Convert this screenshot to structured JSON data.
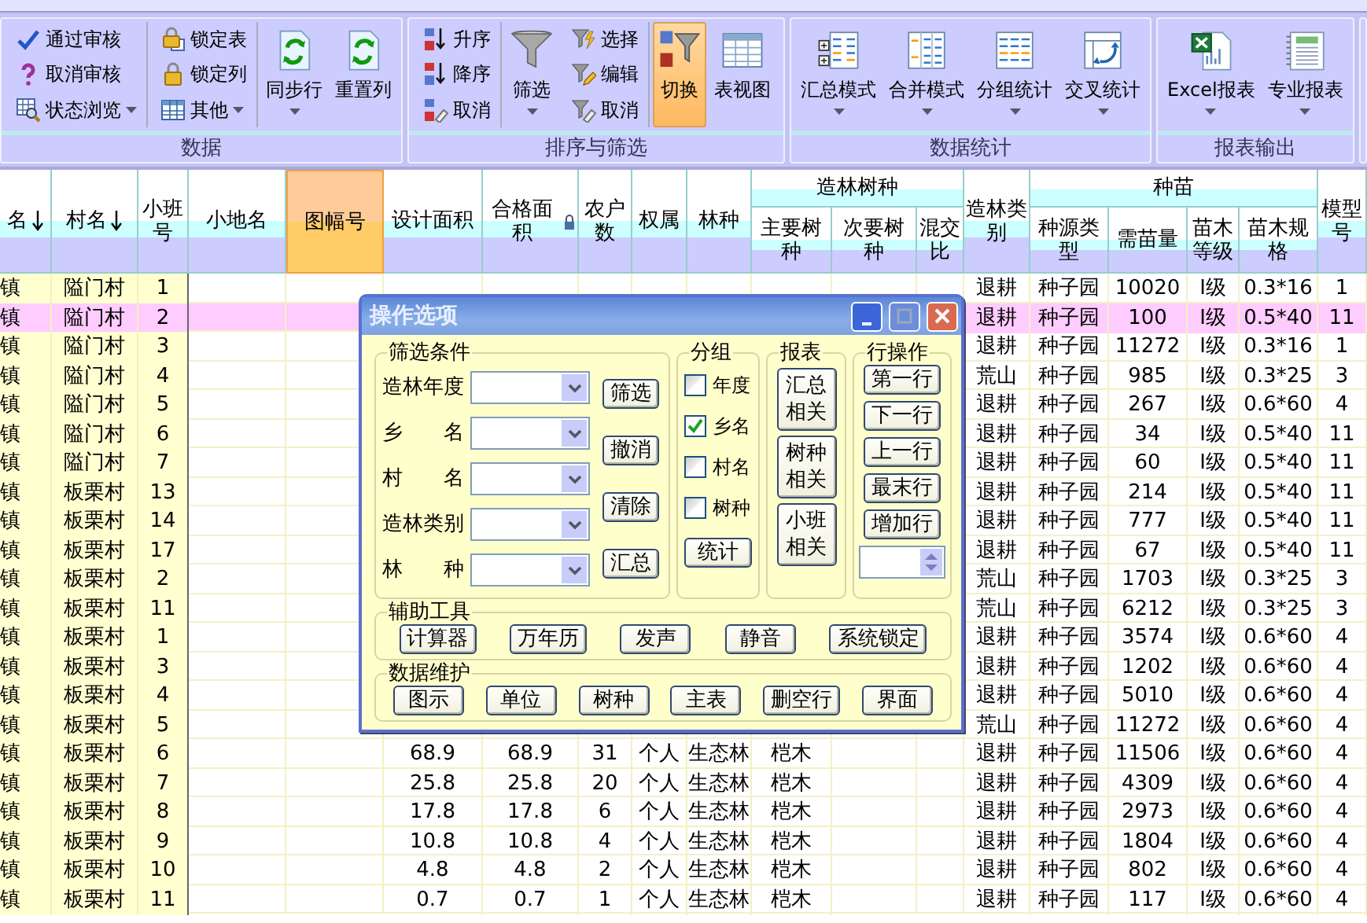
{
  "ribbon": {
    "groups": [
      {
        "title": "数据",
        "columns": [
          {
            "kind": "stack",
            "items": [
              {
                "label": "通过审核",
                "dropdown": false
              },
              {
                "label": "取消审核",
                "dropdown": false
              },
              {
                "label": "状态浏览",
                "dropdown": true
              }
            ]
          },
          {
            "kind": "stack",
            "items": [
              {
                "label": "锁定表",
                "dropdown": false
              },
              {
                "label": "锁定列",
                "dropdown": false
              },
              {
                "label": "其他",
                "dropdown": true
              }
            ]
          },
          {
            "kind": "large",
            "label": "同步行",
            "dropdown": true,
            "selected": false
          },
          {
            "kind": "large",
            "label": "重置列",
            "dropdown": false,
            "selected": false
          }
        ]
      },
      {
        "title": "排序与筛选",
        "columns": [
          {
            "kind": "stack",
            "items": [
              {
                "label": "升序",
                "dropdown": false
              },
              {
                "label": "降序",
                "dropdown": false
              },
              {
                "label": "取消",
                "dropdown": false
              }
            ]
          },
          {
            "kind": "large",
            "label": "筛选",
            "dropdown": true,
            "selected": false
          },
          {
            "kind": "stack",
            "items": [
              {
                "label": "选择",
                "dropdown": false
              },
              {
                "label": "编辑",
                "dropdown": false
              },
              {
                "label": "取消",
                "dropdown": false
              }
            ]
          },
          {
            "kind": "large",
            "label": "切换",
            "dropdown": false,
            "selected": true
          },
          {
            "kind": "large",
            "label": "表视图",
            "dropdown": false,
            "selected": false
          }
        ]
      },
      {
        "title": "数据统计",
        "columns": [
          {
            "kind": "large",
            "label": "汇总模式",
            "dropdown": true,
            "selected": false
          },
          {
            "kind": "large",
            "label": "合并模式",
            "dropdown": true,
            "selected": false
          },
          {
            "kind": "large",
            "label": "分组统计",
            "dropdown": true,
            "selected": false
          },
          {
            "kind": "large",
            "label": "交叉统计",
            "dropdown": true,
            "selected": false
          }
        ]
      },
      {
        "title": "报表输出",
        "columns": [
          {
            "kind": "large",
            "label": "Excel报表",
            "dropdown": true,
            "selected": false
          },
          {
            "kind": "large",
            "label": "专业报表",
            "dropdown": true,
            "selected": false
          }
        ]
      }
    ]
  },
  "table": {
    "columns": [
      {
        "label": "名",
        "sort": true,
        "selected": false
      },
      {
        "label": "村名",
        "sort": true,
        "selected": false
      },
      {
        "label": "小班号",
        "selected": false
      },
      {
        "label": "小地名",
        "selected": false
      },
      {
        "label": "图幅号",
        "selected": true
      },
      {
        "label": "设计面积",
        "selected": false
      },
      {
        "label": "合格面积",
        "locked": true,
        "selected": false
      },
      {
        "label": "农户数",
        "selected": false
      },
      {
        "label": "权属",
        "selected": false
      },
      {
        "label": "林种",
        "selected": false
      },
      {
        "label": "主要树种",
        "group_label": "造林树种",
        "selected": false
      },
      {
        "label": "次要树种",
        "in_group": true,
        "selected": false
      },
      {
        "label": "混交比",
        "in_group": true,
        "selected": false
      },
      {
        "label": "造林类别",
        "selected": false
      },
      {
        "label": "种源类型",
        "group_label": "种苗",
        "selected": false
      },
      {
        "label": "需苗量",
        "in_group": true,
        "selected": false
      },
      {
        "label": "苗木等级",
        "in_group": true,
        "selected": false
      },
      {
        "label": "苗木规格",
        "in_group": true,
        "selected": false
      },
      {
        "label": "模型号",
        "selected": false
      }
    ],
    "rows": [
      {
        "selected": false,
        "cells": [
          "镇",
          "隘门村",
          "1",
          null,
          null,
          null,
          null,
          null,
          null,
          null,
          null,
          null,
          null,
          "退耕",
          "种子园",
          "10020",
          "Ⅰ级",
          "0.3*16",
          "1"
        ]
      },
      {
        "selected": true,
        "cells": [
          "镇",
          "隘门村",
          "2",
          null,
          null,
          null,
          null,
          null,
          null,
          null,
          null,
          null,
          null,
          "退耕",
          "种子园",
          "100",
          "Ⅰ级",
          "0.5*40",
          "11"
        ]
      },
      {
        "selected": false,
        "cells": [
          "镇",
          "隘门村",
          "3",
          null,
          null,
          null,
          null,
          null,
          null,
          null,
          null,
          null,
          null,
          "退耕",
          "种子园",
          "11272",
          "Ⅰ级",
          "0.3*16",
          "1"
        ]
      },
      {
        "selected": false,
        "cells": [
          "镇",
          "隘门村",
          "4",
          null,
          null,
          null,
          null,
          null,
          null,
          null,
          null,
          null,
          null,
          "荒山",
          "种子园",
          "985",
          "Ⅰ级",
          "0.3*25",
          "3"
        ]
      },
      {
        "selected": false,
        "cells": [
          "镇",
          "隘门村",
          "5",
          null,
          null,
          null,
          null,
          null,
          null,
          null,
          null,
          null,
          null,
          "退耕",
          "种子园",
          "267",
          "Ⅰ级",
          "0.6*60",
          "4"
        ]
      },
      {
        "selected": false,
        "cells": [
          "镇",
          "隘门村",
          "6",
          null,
          null,
          null,
          null,
          null,
          null,
          null,
          null,
          null,
          null,
          "退耕",
          "种子园",
          "34",
          "Ⅰ级",
          "0.5*40",
          "11"
        ]
      },
      {
        "selected": false,
        "cells": [
          "镇",
          "隘门村",
          "7",
          null,
          null,
          null,
          null,
          null,
          null,
          null,
          null,
          null,
          null,
          "退耕",
          "种子园",
          "60",
          "Ⅰ级",
          "0.5*40",
          "11"
        ]
      },
      {
        "selected": false,
        "cells": [
          "镇",
          "板栗村",
          "13",
          null,
          null,
          null,
          null,
          null,
          null,
          null,
          null,
          null,
          null,
          "退耕",
          "种子园",
          "214",
          "Ⅰ级",
          "0.5*40",
          "11"
        ]
      },
      {
        "selected": false,
        "cells": [
          "镇",
          "板栗村",
          "14",
          null,
          null,
          null,
          null,
          null,
          null,
          null,
          null,
          null,
          null,
          "退耕",
          "种子园",
          "777",
          "Ⅰ级",
          "0.5*40",
          "11"
        ]
      },
      {
        "selected": false,
        "cells": [
          "镇",
          "板栗村",
          "17",
          null,
          null,
          null,
          null,
          null,
          null,
          null,
          null,
          null,
          null,
          "退耕",
          "种子园",
          "67",
          "Ⅰ级",
          "0.5*40",
          "11"
        ]
      },
      {
        "selected": false,
        "cells": [
          "镇",
          "板栗村",
          "2",
          null,
          null,
          null,
          null,
          null,
          null,
          null,
          null,
          null,
          null,
          "荒山",
          "种子园",
          "1703",
          "Ⅰ级",
          "0.3*25",
          "3"
        ]
      },
      {
        "selected": false,
        "cells": [
          "镇",
          "板栗村",
          "11",
          null,
          null,
          null,
          null,
          null,
          null,
          null,
          null,
          null,
          null,
          "荒山",
          "种子园",
          "6212",
          "Ⅰ级",
          "0.3*25",
          "3"
        ]
      },
      {
        "selected": false,
        "cells": [
          "镇",
          "板栗村",
          "1",
          null,
          null,
          null,
          null,
          null,
          null,
          null,
          null,
          null,
          null,
          "退耕",
          "种子园",
          "3574",
          "Ⅰ级",
          "0.6*60",
          "4"
        ]
      },
      {
        "selected": false,
        "cells": [
          "镇",
          "板栗村",
          "3",
          null,
          null,
          null,
          null,
          null,
          null,
          null,
          null,
          null,
          null,
          "退耕",
          "种子园",
          "1202",
          "Ⅰ级",
          "0.6*60",
          "4"
        ]
      },
      {
        "selected": false,
        "cells": [
          "镇",
          "板栗村",
          "4",
          null,
          null,
          null,
          null,
          null,
          null,
          null,
          null,
          null,
          null,
          "退耕",
          "种子园",
          "5010",
          "Ⅰ级",
          "0.6*60",
          "4"
        ]
      },
      {
        "selected": false,
        "cells": [
          "镇",
          "板栗村",
          "5",
          null,
          null,
          null,
          null,
          null,
          null,
          null,
          null,
          null,
          null,
          "荒山",
          "种子园",
          "11272",
          "Ⅰ级",
          "0.6*60",
          "4"
        ]
      },
      {
        "selected": false,
        "cells": [
          "镇",
          "板栗村",
          "6",
          null,
          null,
          "68.9",
          "68.9",
          "31",
          "个人",
          "生态林",
          "桤木",
          null,
          null,
          "退耕",
          "种子园",
          "11506",
          "Ⅰ级",
          "0.6*60",
          "4"
        ]
      },
      {
        "selected": false,
        "cells": [
          "镇",
          "板栗村",
          "7",
          null,
          null,
          "25.8",
          "25.8",
          "20",
          "个人",
          "生态林",
          "桤木",
          null,
          null,
          "退耕",
          "种子园",
          "4309",
          "Ⅰ级",
          "0.6*60",
          "4"
        ]
      },
      {
        "selected": false,
        "cells": [
          "镇",
          "板栗村",
          "8",
          null,
          null,
          "17.8",
          "17.8",
          "6",
          "个人",
          "生态林",
          "桤木",
          null,
          null,
          "退耕",
          "种子园",
          "2973",
          "Ⅰ级",
          "0.6*60",
          "4"
        ]
      },
      {
        "selected": false,
        "cells": [
          "镇",
          "板栗村",
          "9",
          null,
          null,
          "10.8",
          "10.8",
          "4",
          "个人",
          "生态林",
          "桤木",
          null,
          null,
          "退耕",
          "种子园",
          "1804",
          "Ⅰ级",
          "0.6*60",
          "4"
        ]
      },
      {
        "selected": false,
        "cells": [
          "镇",
          "板栗村",
          "10",
          null,
          null,
          "4.8",
          "4.8",
          "2",
          "个人",
          "生态林",
          "桤木",
          null,
          null,
          "退耕",
          "种子园",
          "802",
          "Ⅰ级",
          "0.6*60",
          "4"
        ]
      },
      {
        "selected": false,
        "cells": [
          "镇",
          "板栗村",
          "11",
          null,
          null,
          "0.7",
          "0.7",
          "1",
          "个人",
          "生态林",
          "桤木",
          null,
          null,
          "退耕",
          "种子园",
          "117",
          "Ⅰ级",
          "0.6*60",
          "4"
        ]
      }
    ]
  },
  "dialog": {
    "title": "操作选项",
    "filter": {
      "title": "筛选条件",
      "fields": [
        {
          "label": "造林年度"
        },
        {
          "label": "乡名"
        },
        {
          "label": "村名"
        },
        {
          "label": "造林类别"
        },
        {
          "label": "林种"
        }
      ],
      "buttons": [
        "筛选",
        "撤消",
        "清除",
        "汇总"
      ]
    },
    "grouping": {
      "title": "分组",
      "options": [
        {
          "label": "年度",
          "checked": false
        },
        {
          "label": "乡名",
          "checked": true
        },
        {
          "label": "村名",
          "checked": false
        },
        {
          "label": "树种",
          "checked": false
        }
      ],
      "button": "统计"
    },
    "report": {
      "title": "报表",
      "buttons": [
        "汇总相关",
        "树种相关",
        "小班相关"
      ]
    },
    "row_ops": {
      "title": "行操作",
      "buttons": [
        "第一行",
        "下一行",
        "上一行",
        "最末行",
        "增加行"
      ]
    },
    "tools": {
      "title": "辅助工具",
      "buttons": [
        "计算器",
        "万年历",
        "发声",
        "静音",
        "系统锁定"
      ]
    },
    "maintenance": {
      "title": "数据维护",
      "buttons": [
        "图示",
        "单位",
        "树种",
        "主表",
        "删空行",
        "界面"
      ]
    }
  }
}
